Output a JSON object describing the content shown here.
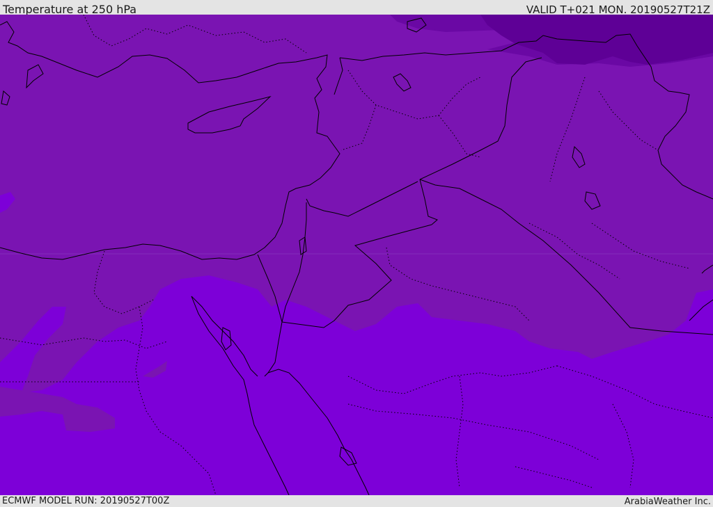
{
  "header": {
    "title": "Temperature at 250 hPa",
    "valid": "VALID T+021 MON. 20190527T21Z"
  },
  "footer": {
    "model_run": "ECMWF MODEL RUN: 20190527T00Z",
    "credit": "ArabiaWeather Inc."
  },
  "colors": {
    "background_bar": "#e4e4e4",
    "field_cold": "#5c0096",
    "field_mid": "#7a14b2",
    "field_warm": "#7d00d8",
    "field_coldest": "#630099",
    "border_line": "#000000"
  }
}
